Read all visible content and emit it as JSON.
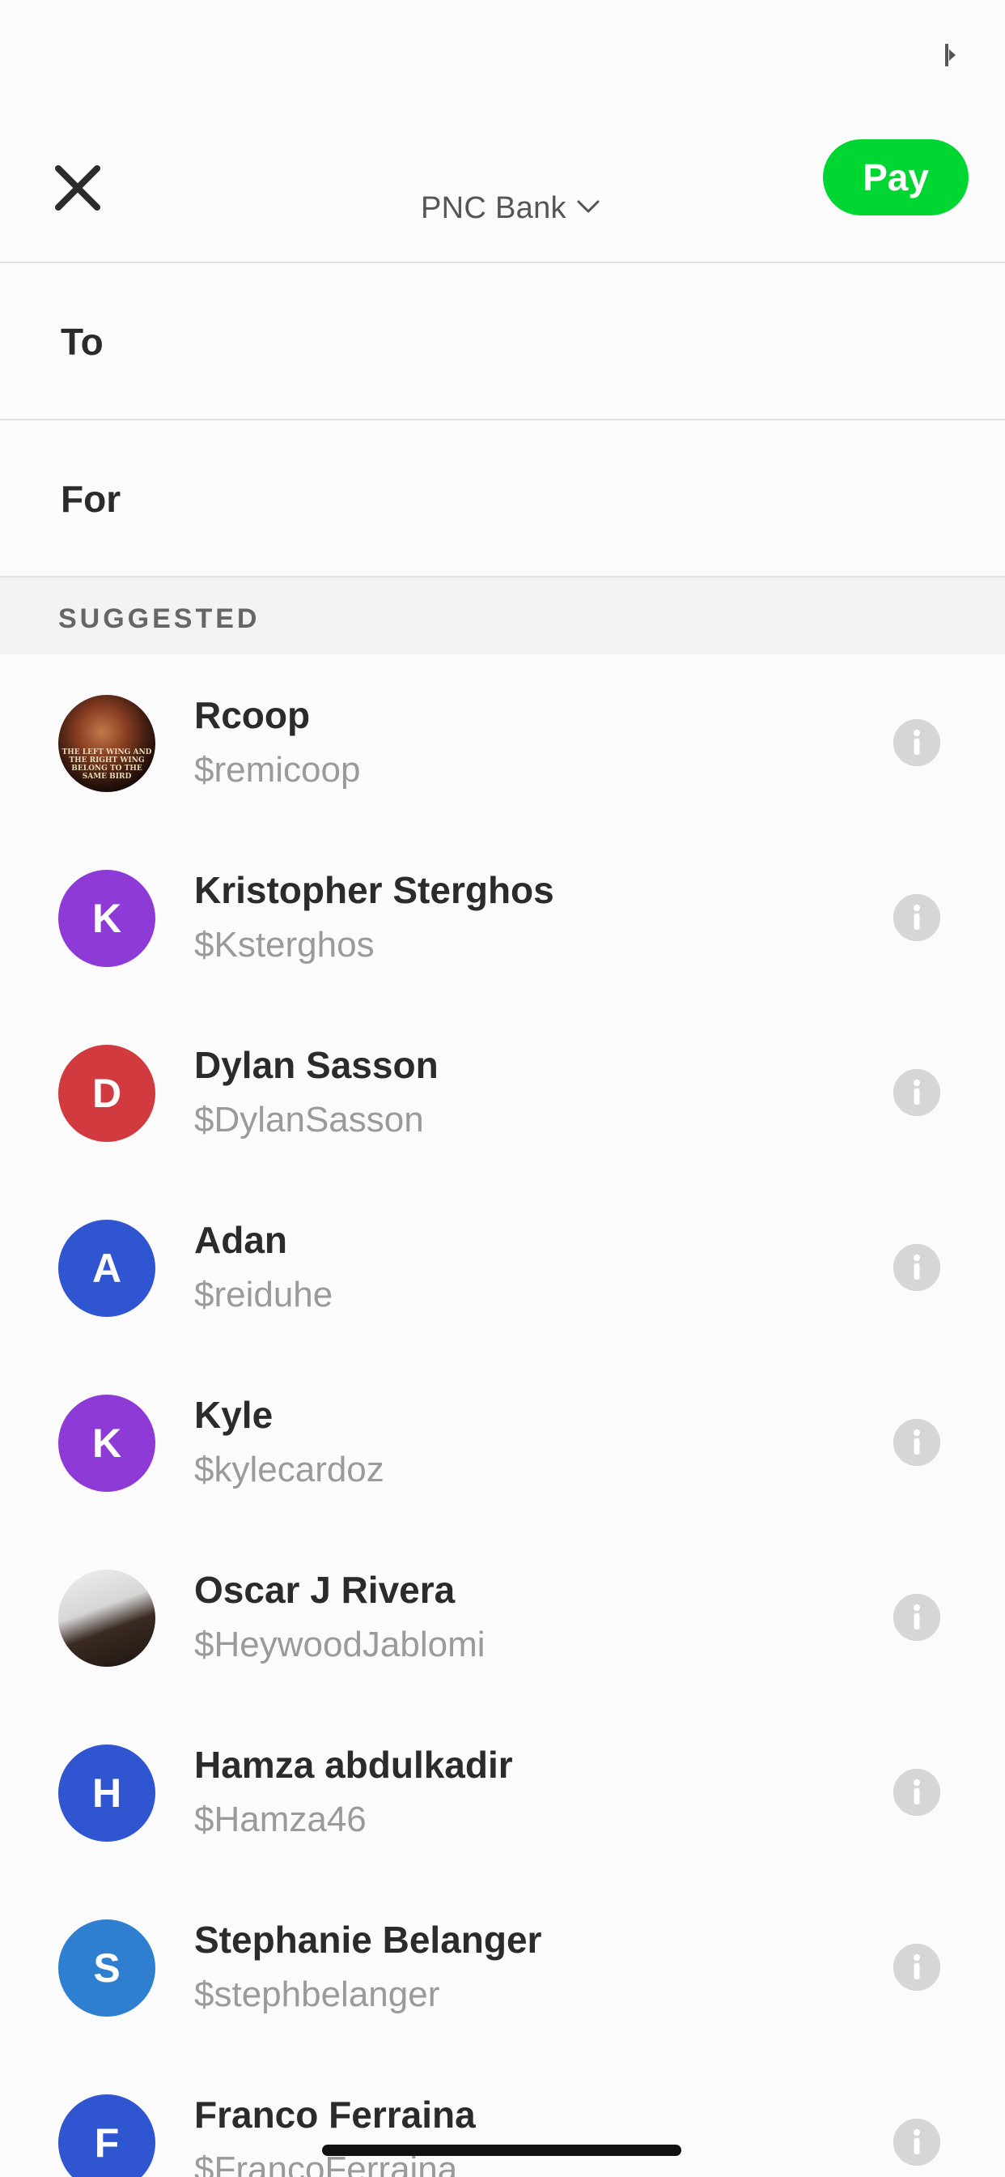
{
  "colors": {
    "accent": "#00d632",
    "background": "#fbfbfb",
    "section_bg": "#f3f3f3",
    "divider": "#e3e3e3",
    "text_primary": "#2b2b2b",
    "text_secondary": "#9a9a9a"
  },
  "header": {
    "close_icon": "close-icon",
    "funding_source": "PNC Bank",
    "chevron_icon": "chevron-down-icon",
    "pay_label": "Pay"
  },
  "form": {
    "to_label": "To",
    "to_value": "",
    "for_label": "For",
    "for_value": ""
  },
  "suggested": {
    "title": "SUGGESTED",
    "contacts": [
      {
        "name": "Rcoop",
        "handle": "$remicoop",
        "avatar_type": "photo",
        "avatar_caption": "THE LEFT WING AND THE RIGHT WING BELONG TO THE SAME BIRD",
        "color": "#5a2a18"
      },
      {
        "name": "Kristopher Sterghos",
        "handle": "$Ksterghos",
        "avatar_type": "initial",
        "initial": "K",
        "color": "#8e3ad6"
      },
      {
        "name": "Dylan Sasson",
        "handle": "$DylanSasson",
        "avatar_type": "initial",
        "initial": "D",
        "color": "#d13a3f"
      },
      {
        "name": "Adan",
        "handle": "$reiduhe",
        "avatar_type": "initial",
        "initial": "A",
        "color": "#2f55d0"
      },
      {
        "name": "Kyle",
        "handle": "$kylecardoz",
        "avatar_type": "initial",
        "initial": "K",
        "color": "#8e3ad6"
      },
      {
        "name": "Oscar J Rivera",
        "handle": "$HeywoodJablomi",
        "avatar_type": "photo",
        "color": "#3a2a22"
      },
      {
        "name": "Hamza abdulkadir",
        "handle": "$Hamza46",
        "avatar_type": "initial",
        "initial": "H",
        "color": "#2f55d0"
      },
      {
        "name": "Stephanie Belanger",
        "handle": "$stephbelanger",
        "avatar_type": "initial",
        "initial": "S",
        "color": "#2f7fd0"
      },
      {
        "name": "Franco Ferraina",
        "handle": "$FrancoFerraina",
        "avatar_type": "initial",
        "initial": "F",
        "color": "#2f55d0"
      }
    ]
  }
}
